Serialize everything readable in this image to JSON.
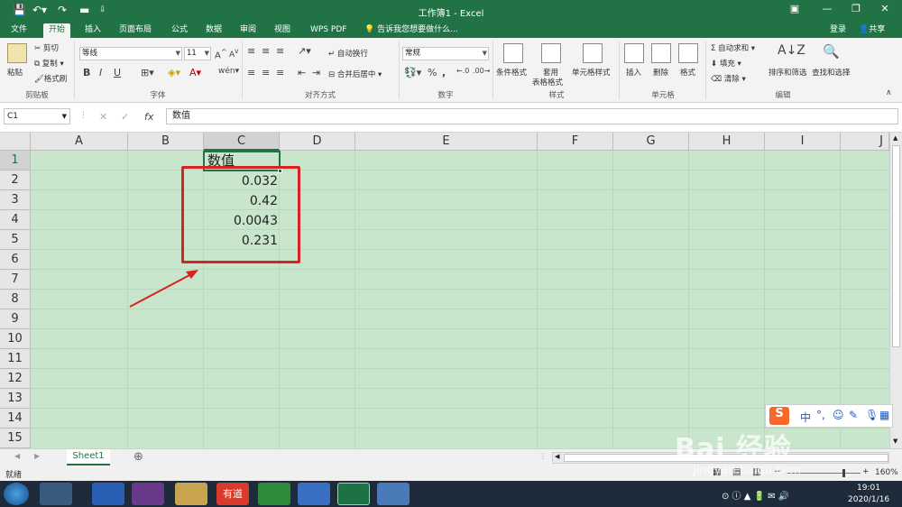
{
  "window": {
    "title": "工作簿1 - Excel",
    "restore_icon": "ribbon-display-icon",
    "minimize": "—",
    "maximize": "❐",
    "close": "✕"
  },
  "quick_access": {
    "save": "save-icon",
    "undo": "undo-icon",
    "redo": "redo-icon",
    "new": "new-file-icon"
  },
  "tabs": [
    "文件",
    "开始",
    "插入",
    "页面布局",
    "公式",
    "数据",
    "审阅",
    "视图",
    "WPS PDF"
  ],
  "active_tab": "开始",
  "tell_me": "告诉我您想要做什么...",
  "account": {
    "login": "登录",
    "share": "共享"
  },
  "ribbon": {
    "clipboard": {
      "paste": "粘贴",
      "cut": "剪切",
      "copy": "复制",
      "format_painter": "格式刷",
      "group": "剪贴板"
    },
    "font": {
      "name": "等线",
      "size": "11",
      "bold": "B",
      "italic": "I",
      "underline": "U",
      "group": "字体"
    },
    "alignment": {
      "wrap": "自动换行",
      "merge": "合并后居中",
      "group": "对齐方式"
    },
    "number": {
      "format": "常规",
      "percent": "%",
      "comma": ",",
      "group": "数字"
    },
    "styles": {
      "conditional": "条件格式",
      "table_line1": "套用",
      "table_line2": "表格格式",
      "cell_styles": "单元格样式",
      "group": "样式"
    },
    "cells": {
      "insert": "插入",
      "delete": "删除",
      "format": "格式",
      "group": "单元格"
    },
    "editing": {
      "autosum": "自动求和",
      "fill": "填充",
      "clear": "清除",
      "sort": "排序和筛选",
      "find": "查找和选择",
      "group": "编辑"
    }
  },
  "formula_bar": {
    "name_box": "C1",
    "fx": "fx",
    "value": "数值"
  },
  "columns": [
    "A",
    "B",
    "C",
    "D",
    "E",
    "F",
    "G",
    "H",
    "I",
    "J"
  ],
  "rows": [
    "1",
    "2",
    "3",
    "4",
    "5",
    "6",
    "7",
    "8",
    "9",
    "10",
    "11",
    "12",
    "13",
    "14",
    "15"
  ],
  "cells": {
    "C1": "数值",
    "C2": "0.032",
    "C3": "0.42",
    "C4": "0.0043",
    "C5": "0.231"
  },
  "sheet_tabs": [
    "Sheet1"
  ],
  "status": {
    "mode": "就绪",
    "zoom": "160%"
  },
  "taskbar": {
    "time": "19:01",
    "date": "2020/1/16"
  },
  "ime": {
    "label": "中"
  },
  "watermark": {
    "brand": "Bai 经验",
    "url": "jingyan.baidu.com"
  },
  "colors": {
    "excel_green": "#217346",
    "grid_bg": "#c9e6cc",
    "highlight": "#d62222"
  }
}
